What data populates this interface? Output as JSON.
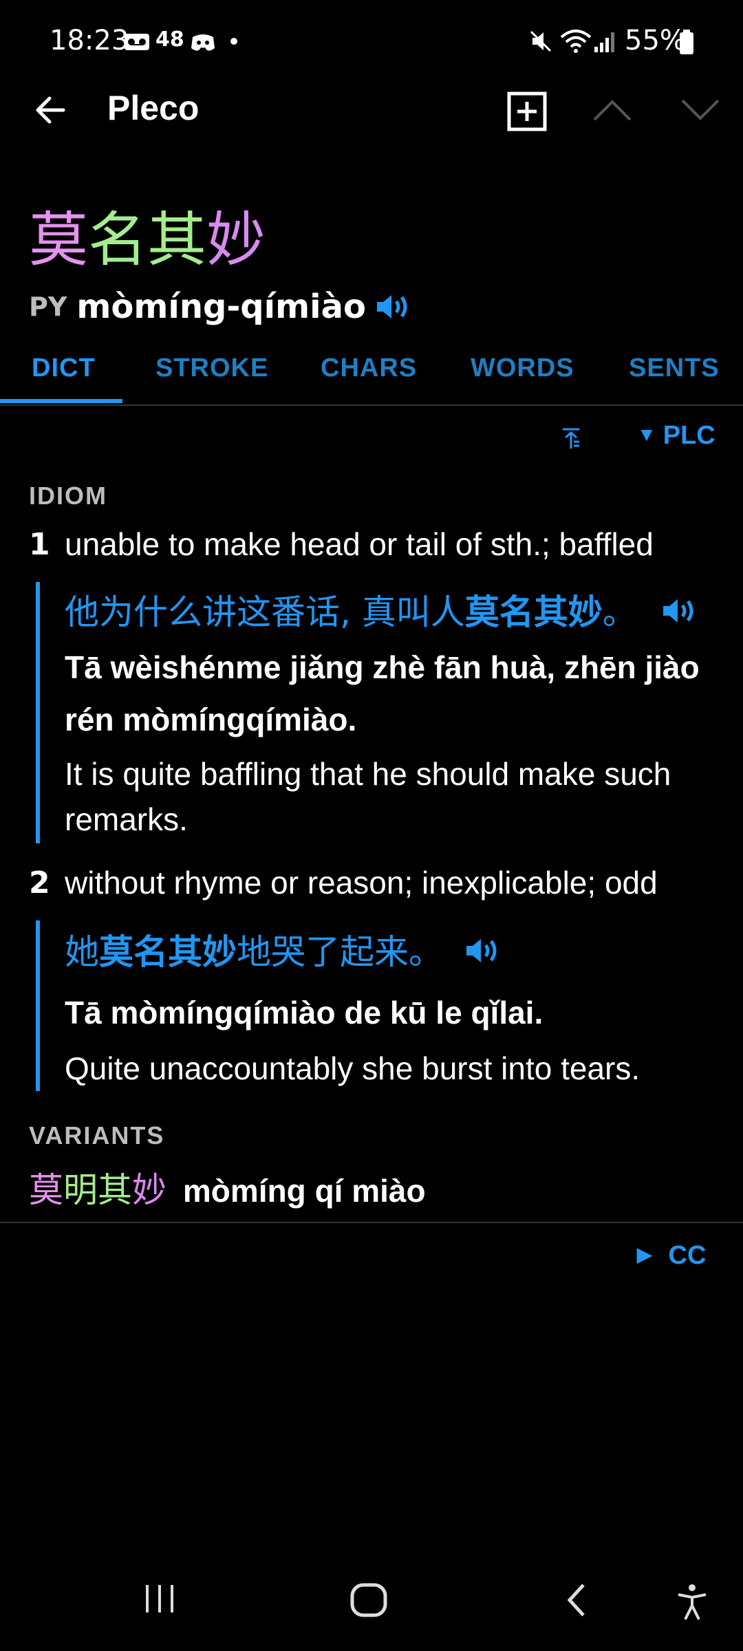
{
  "status_bar": {
    "time": "18:23",
    "notif_count": "48",
    "battery": "55%",
    "icons": [
      "voicemail-icon",
      "discord-icon",
      "dot-icon",
      "mute-icon",
      "wifi-icon",
      "signal-icon",
      "battery-icon"
    ]
  },
  "app_bar": {
    "title": "Pleco",
    "icons": [
      "back-arrow-icon",
      "add-box-icon",
      "chevron-up-icon",
      "chevron-down-icon"
    ]
  },
  "headword": {
    "chars": [
      "莫",
      "名",
      "其",
      "妙"
    ],
    "colors": [
      "#e592f0",
      "#a4ec8e",
      "#a4ec8e",
      "#d98af0"
    ],
    "py_label": "PY",
    "pinyin": "mòmíng-qímiào"
  },
  "tabs": [
    {
      "label": "DICT",
      "active": true
    },
    {
      "label": "STROKE",
      "active": false
    },
    {
      "label": "CHARS",
      "active": false
    },
    {
      "label": "WORDS",
      "active": false
    },
    {
      "label": "SENTS",
      "active": false
    }
  ],
  "toolbar": {
    "dict_label": "PLC",
    "dict_arrow": "▼"
  },
  "entry": {
    "section": "IDIOM",
    "senses": [
      {
        "num": "1",
        "definition": "unable to make head or tail of sth.; baffled",
        "example": {
          "zh_pre": "他为什么讲这番话, 真叫人",
          "zh_bold": "莫名其妙",
          "zh_post": "。",
          "py_line1": "Tā wèishénme jiǎng zhè fān huà, zhēn jiào",
          "py_line2_norm": "rén ",
          "py_line2_bold": "mòmíngqímiào",
          "py_line2_post": ".",
          "en_line1": "It is quite baffling that he should make such",
          "en_line2": "remarks."
        }
      },
      {
        "num": "2",
        "definition": "without rhyme or reason; inexplicable; odd",
        "example": {
          "zh_pre": "她",
          "zh_bold": "莫名其妙",
          "zh_post": "地哭了起来。",
          "py_pre": "Tā ",
          "py_bold": "mòmíngqímiào",
          "py_post": " de kū le qǐlai.",
          "en_line1": "Quite unaccountably she burst into tears."
        }
      }
    ],
    "variants_label": "VARIANTS",
    "variant": {
      "chars": [
        "莫",
        "明",
        "其",
        "妙"
      ],
      "colors": [
        "#e592f0",
        "#a4ec8e",
        "#a4ec8e",
        "#d98af0"
      ],
      "pinyin": "mòmíng qí miào"
    }
  },
  "footer_dict": {
    "label": "CC",
    "arrow": "▶"
  },
  "nav_bar": {
    "icons": [
      "recents-icon",
      "home-icon",
      "back-icon",
      "accessibility-icon"
    ]
  }
}
